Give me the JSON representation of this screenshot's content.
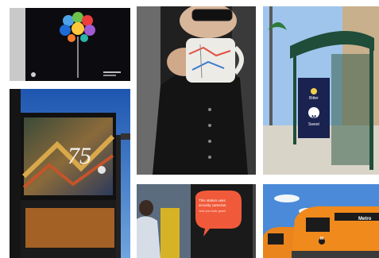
{
  "gallery": {
    "tiles": [
      {
        "id": "balloon-poster",
        "caption": ""
      },
      {
        "id": "coffee-mug",
        "caption": ""
      },
      {
        "id": "bus-shelter",
        "caption": ""
      },
      {
        "id": "billboard-75",
        "caption": ""
      },
      {
        "id": "station-sign",
        "caption": ""
      },
      {
        "id": "metro-trains",
        "caption": ""
      }
    ]
  },
  "billboard": {
    "number": "75"
  },
  "shelter_ad": {
    "line1": "Bitter",
    "line2": "Sweet",
    "logo_letter": "M"
  },
  "station_sign": {
    "line1": "This station uses",
    "line2": "security cameras.",
    "line3": "Just you look great."
  },
  "train": {
    "label": "Metro",
    "logo_letter": "M"
  },
  "colors": {
    "metro_orange": "#f08a1c",
    "shelter_green": "#1f4d3a",
    "speech_bubble": "#f05a3a",
    "poster_black": "#0c0c10",
    "sky_blue": "#2a6fc4"
  }
}
